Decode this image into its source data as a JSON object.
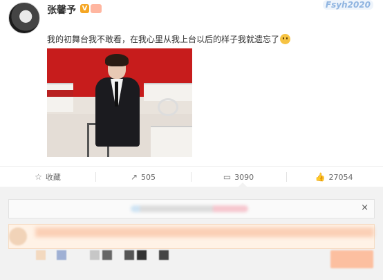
{
  "post": {
    "username": "张馨予",
    "verified_mark": "V",
    "watermark": "Fsyh2020",
    "text": "我的初舞台我不敢看，在我心里从我上台以后的样子我就遗忘了"
  },
  "actions": [
    {
      "icon": "star-icon",
      "glyph": "☆",
      "label": "收藏"
    },
    {
      "icon": "share-icon",
      "glyph": "↗",
      "label": "505"
    },
    {
      "icon": "comment-icon",
      "glyph": "▭",
      "label": "3090"
    },
    {
      "icon": "like-icon",
      "glyph": "👍",
      "label": "27054"
    }
  ],
  "colors": {
    "accent": "#f5a623",
    "comment_button": "#ffb38c"
  }
}
